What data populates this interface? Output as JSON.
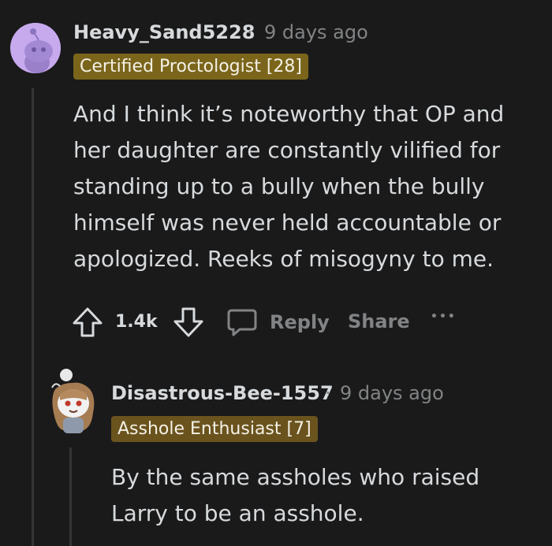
{
  "comments": [
    {
      "username": "Heavy_Sand5228",
      "separator": "·",
      "timestamp": "9 days ago",
      "flair": "Certified Proctologist [28]",
      "flair_color": "#7a651b",
      "avatar": "reddit-snoo-purple",
      "body_lines": [
        "And I think it’s noteworthy that OP and",
        "her daughter are constantly vilified for",
        "standing up to a bully when the bully",
        "himself was never held accountable or",
        "apologized. Reeks of misogyny to me."
      ],
      "actions": {
        "votes": "1.4k",
        "reply_label": "Reply",
        "share_label": "Share",
        "more_label": "•••"
      }
    },
    {
      "username": "Disastrous-Bee-1557",
      "separator": "·",
      "timestamp": "9 days ago",
      "flair": "Asshole Enthusiast [7]",
      "flair_color": "#6b531e",
      "avatar": "reddit-snoo-anime-girl",
      "body_lines": [
        "By the same assholes who raised",
        "Larry to be an asshole."
      ]
    }
  ],
  "colors": {
    "background": "#1a1a1b",
    "text": "#d7dadc",
    "muted": "#818384",
    "thread_line": "#343536"
  }
}
